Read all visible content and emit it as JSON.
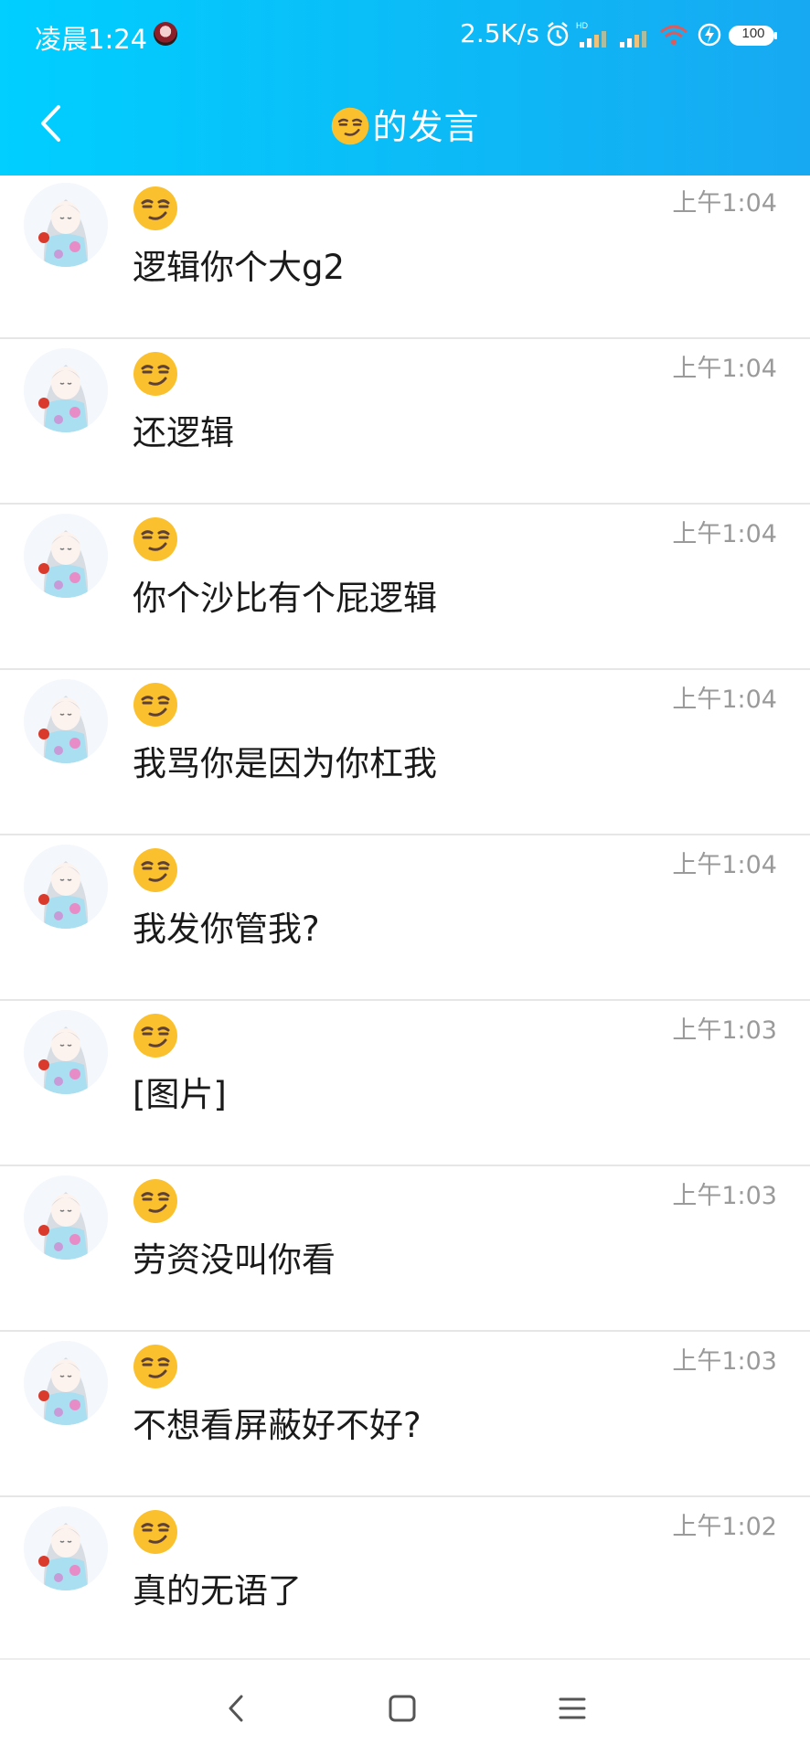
{
  "status_bar": {
    "time": "凌晨1:24",
    "network_speed": "2.5K/s",
    "battery": "100"
  },
  "header": {
    "title": "的发言",
    "title_emoji": "smirk-emoji-icon"
  },
  "messages": [
    {
      "name_emoji": "smirk-emoji-icon",
      "text": "逻辑你个大g2",
      "time": "上午1:04"
    },
    {
      "name_emoji": "smirk-emoji-icon",
      "text": "还逻辑",
      "time": "上午1:04"
    },
    {
      "name_emoji": "smirk-emoji-icon",
      "text": "你个沙比有个屁逻辑",
      "time": "上午1:04"
    },
    {
      "name_emoji": "smirk-emoji-icon",
      "text": "我骂你是因为你杠我",
      "time": "上午1:04"
    },
    {
      "name_emoji": "smirk-emoji-icon",
      "text": "我发你管我?",
      "time": "上午1:04"
    },
    {
      "name_emoji": "smirk-emoji-icon",
      "text": "[图片]",
      "time": "上午1:03"
    },
    {
      "name_emoji": "smirk-emoji-icon",
      "text": "劳资没叫你看",
      "time": "上午1:03"
    },
    {
      "name_emoji": "smirk-emoji-icon",
      "text": "不想看屏蔽好不好?",
      "time": "上午1:03"
    },
    {
      "name_emoji": "smirk-emoji-icon",
      "text": "真的无语了",
      "time": "上午1:02"
    }
  ],
  "colors": {
    "header_start": "#00cfff",
    "header_end": "#17a9f2",
    "timestamp": "#9a9a9a",
    "divider": "#e6e6e6"
  },
  "nav_bar": {
    "back": "back-triangle-icon",
    "home": "home-square-icon",
    "menu": "menu-lines-icon"
  }
}
